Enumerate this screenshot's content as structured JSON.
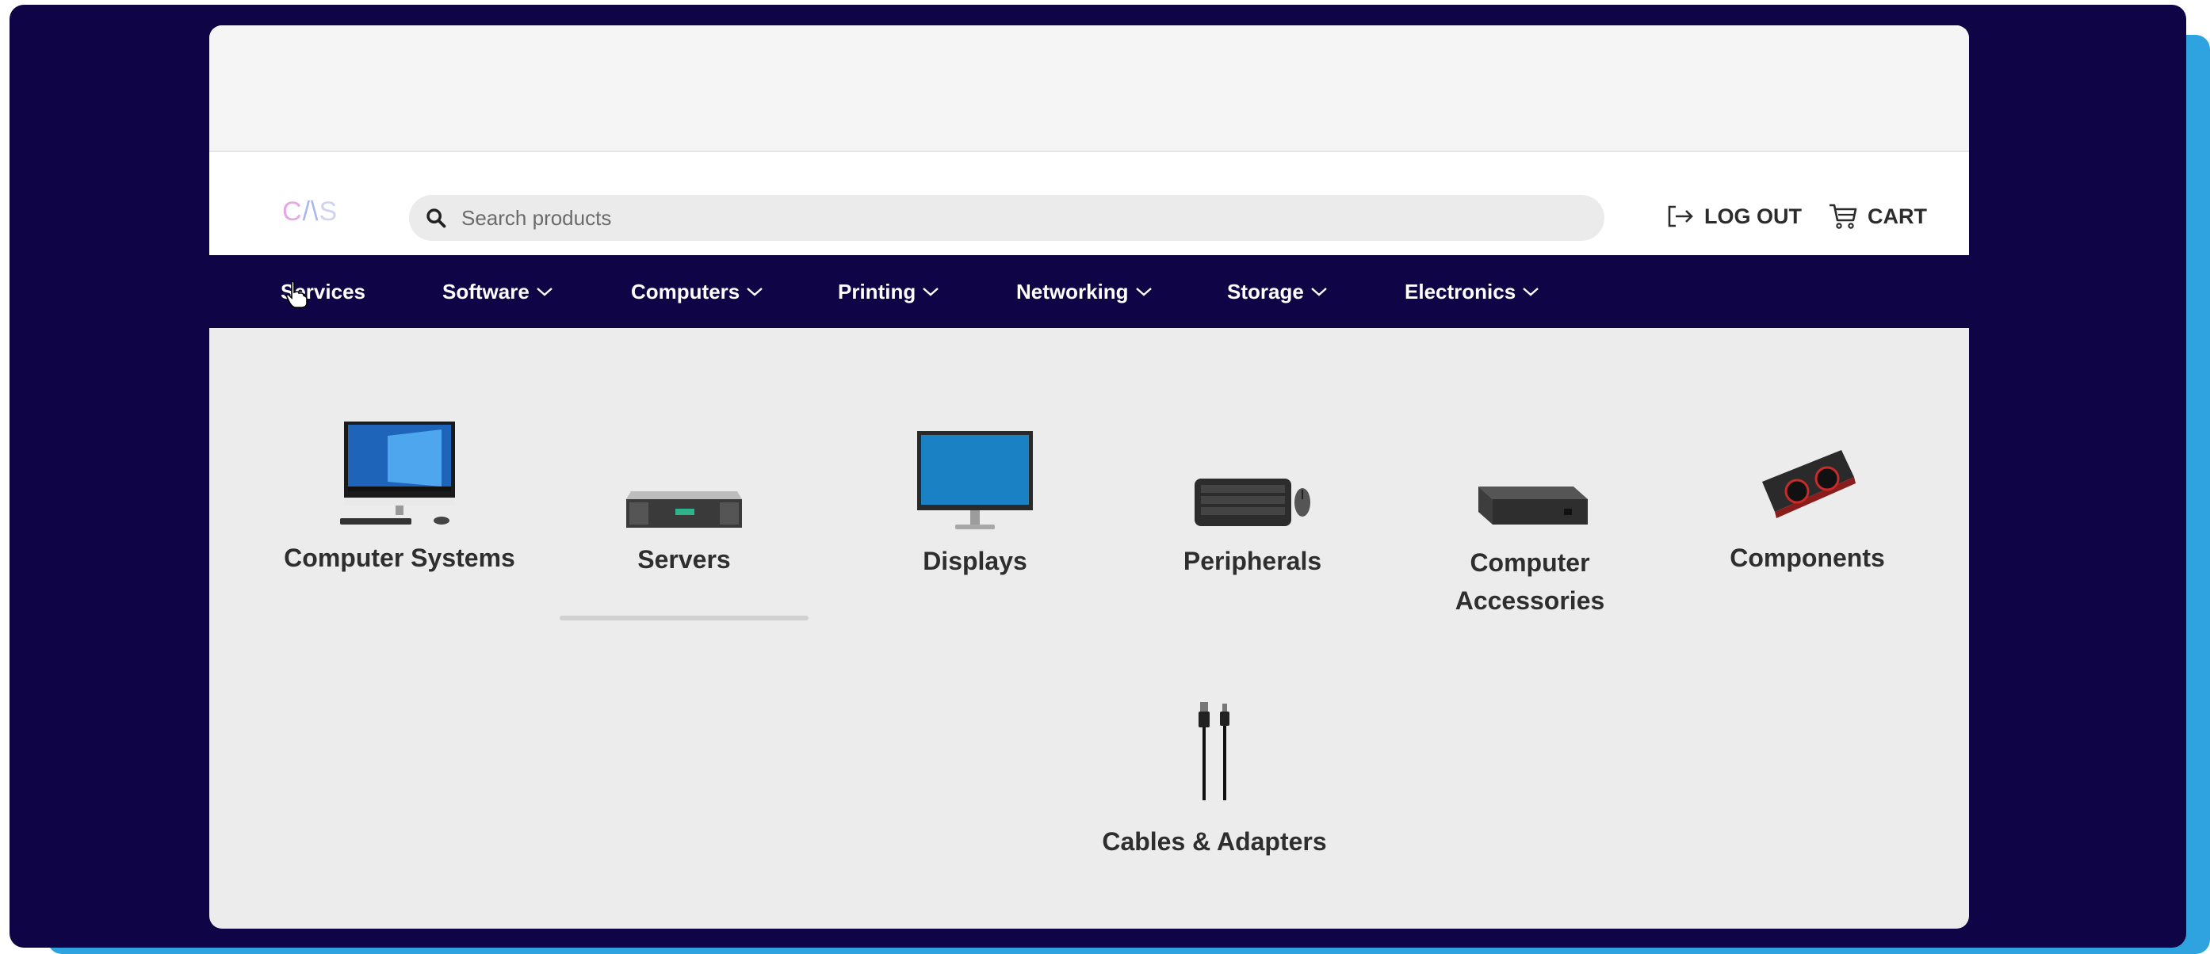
{
  "header": {
    "logo_text_a": "C",
    "logo_text_b": "/\\",
    "logo_text_c": "S",
    "search_placeholder": "Search products",
    "logout_label": "LOG OUT",
    "cart_label": "CART"
  },
  "nav": {
    "items": [
      {
        "label": "Services"
      },
      {
        "label": "Software"
      },
      {
        "label": "Computers"
      },
      {
        "label": "Printing"
      },
      {
        "label": "Networking"
      },
      {
        "label": "Storage"
      },
      {
        "label": "Electronics"
      }
    ]
  },
  "categories": [
    {
      "label": "Computer Systems",
      "icon": "desktop-computer-icon"
    },
    {
      "label": "Servers",
      "icon": "server-icon"
    },
    {
      "label": "Displays",
      "icon": "monitor-icon"
    },
    {
      "label": "Peripherals",
      "icon": "keyboard-mouse-icon"
    },
    {
      "label_line1": "Computer",
      "label_line2": "Accessories",
      "icon": "docking-station-icon"
    },
    {
      "label": "Components",
      "icon": "graphics-card-icon"
    },
    {
      "label": "Cables & Adapters",
      "icon": "cables-icon"
    }
  ],
  "colors": {
    "navy": "#0f0445",
    "accent_blue": "#2ea3df",
    "content_bg": "#ececec"
  }
}
